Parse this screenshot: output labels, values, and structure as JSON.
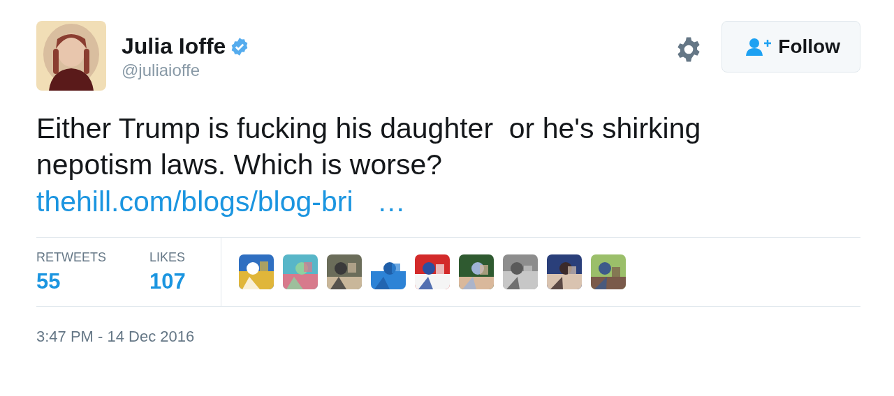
{
  "author": {
    "name": "Julia Ioffe",
    "handle": "@juliaioffe",
    "verified": true
  },
  "follow_button": {
    "label": "Follow"
  },
  "tweet": {
    "text": "Either Trump is fucking his daughter  or he's shirking nepotism laws. Which is worse?",
    "link": "thehill.com/blogs/blog-bri   …"
  },
  "stats": [
    {
      "label": "RETWEETS",
      "value": "55"
    },
    {
      "label": "LIKES",
      "value": "107"
    }
  ],
  "timestamp": "3:47 PM - 14 Dec 2016"
}
